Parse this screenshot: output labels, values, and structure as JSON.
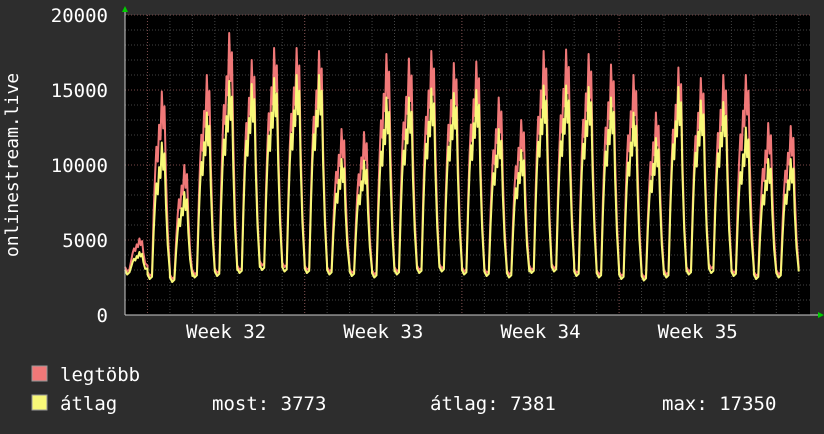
{
  "chart_data": {
    "type": "line",
    "ylabel": "onlinestream.live",
    "ylim": [
      0,
      20000
    ],
    "yticks": [
      0,
      5000,
      10000,
      15000,
      20000
    ],
    "xlim": [
      0,
      30.5
    ],
    "x_major_labels": [
      "Week 32",
      "Week 33",
      "Week 34",
      "Week 35"
    ],
    "x_major_positions": [
      4.5,
      11.5,
      18.5,
      25.5
    ],
    "grid": true,
    "colors": {
      "background": "#2d2d2d",
      "plot": "#000000",
      "grid": "#444444",
      "max_series": "#f07878",
      "avg_series": "#f8f878",
      "axis_arrow": "#00cc00"
    },
    "series": [
      {
        "name": "legtöbb",
        "color": "#f07878",
        "x_unit": "days",
        "day_peaks": [
          5100,
          14900,
          10000,
          16000,
          18800,
          17000,
          17800,
          17800,
          17600,
          12400,
          12200,
          17400,
          17100,
          17600,
          16800,
          16900,
          14500,
          13000,
          17600,
          17700,
          17400,
          16700,
          16000,
          13500,
          16500,
          15800,
          16000,
          16000,
          12800,
          12600
        ],
        "day_troughs": [
          2900,
          2600,
          2400,
          2700,
          2800,
          3000,
          3300,
          3200,
          3000,
          2900,
          2800,
          2700,
          2900,
          3000,
          3100,
          2900,
          2800,
          2700,
          3000,
          3100,
          2800,
          2700,
          2600,
          2500,
          2700,
          2900,
          3100,
          2800,
          2600,
          2700
        ]
      },
      {
        "name": "átlag",
        "color": "#f8f878",
        "x_unit": "days",
        "day_peaks": [
          4200,
          11500,
          8200,
          13500,
          15600,
          15400,
          15800,
          16000,
          16000,
          10400,
          10300,
          14500,
          14500,
          15100,
          14800,
          15000,
          12400,
          11000,
          15300,
          15300,
          15200,
          14500,
          13500,
          11800,
          15200,
          14300,
          14200,
          12500,
          10400,
          10400
        ],
        "day_troughs": [
          2700,
          2400,
          2200,
          2500,
          2600,
          2800,
          3000,
          2900,
          2800,
          2700,
          2600,
          2500,
          2700,
          2800,
          2900,
          2700,
          2600,
          2500,
          2800,
          2900,
          2600,
          2500,
          2400,
          2300,
          2500,
          2700,
          2800,
          2600,
          2400,
          2500
        ]
      }
    ]
  },
  "legend": {
    "max_label": "legtöbb",
    "avg_label": "átlag",
    "most": "most: 3773",
    "atlag": "átlag: 7381",
    "max": "max: 17350"
  }
}
